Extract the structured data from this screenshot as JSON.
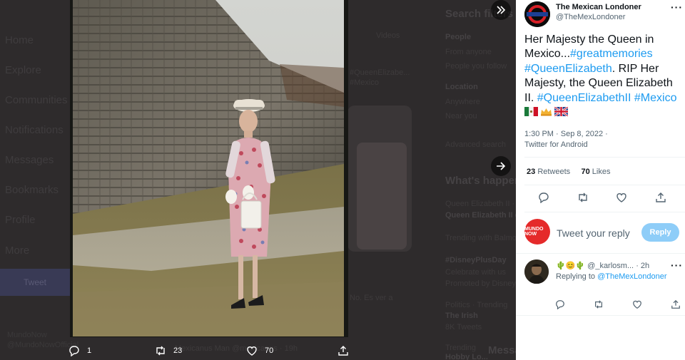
{
  "background": {
    "nav": [
      "Home",
      "Explore",
      "Communities",
      "Notifications",
      "Messages",
      "Bookmarks",
      "Profile",
      "More"
    ],
    "tweet_button": "Tweet",
    "account_name": "MundoNow",
    "account_handle": "@MundoNowOfficial",
    "search_title": "Search filters",
    "videos_tab": "Videos",
    "people_label": "People",
    "from_anyone": "From anyone",
    "people_you_follow": "People you follow",
    "location_label": "Location",
    "anywhere": "Anywhere",
    "near_you": "Near you",
    "advanced_search": "Advanced search",
    "whats_happening": "What's happening",
    "trend1_meta": "Queen Elizabeth II · LIVE",
    "trend1_title": "Queen Elizabeth II dies at 96",
    "trend1_sub": "Trending with Balmoral",
    "trend2_title": "#DisneyPlusDay",
    "trend2_sub": "Celebrate with us",
    "trend2_promo": "Promoted by Disney+",
    "trend3_meta": "Politics · Trending",
    "trend3_title": "The Irish",
    "trend3_sub": "8K Tweets",
    "trend4_meta": "Trending",
    "trend4_title": "Hobby Lo...",
    "messages_drawer": "Messages",
    "bg_author": "Mexicanus Man @mexicanus · 19h",
    "bg_tweet_fragment": "#QueenElizabe...",
    "bg_mexico": "#Mexico",
    "bg_es_verdad": "No. Es ver a"
  },
  "media_bar": {
    "replies": "1",
    "retweets": "23",
    "likes": "70"
  },
  "tweet": {
    "author_name": "The Mexican Londoner",
    "author_handle": "@TheMexLondoner",
    "text_1": "Her Majesty the Queen in Mexico...",
    "tag_1": "#greatmemories",
    "tag_2": "#QueenElizabeth",
    "text_2": ". RIP Her Majesty, the Queen Elizabeth II. ",
    "tag_3": "#QueenElizabethII",
    "tag_4": "#Mexico",
    "timestamp": "1:30 PM · Sep 8, 2022 ·",
    "source": "Twitter for Android",
    "retweets_count": "23",
    "retweets_label": "Retweets",
    "likes_count": "70",
    "likes_label": "Likes"
  },
  "compose": {
    "avatar_text": "MUNDO NOW",
    "placeholder": "Tweet your reply",
    "reply_button": "Reply"
  },
  "reply": {
    "emoji_name": "🌵😊🌵",
    "handle": "@_karlosm...",
    "time": "· 2h",
    "replying_to_label": "Replying to",
    "replying_to_handle": "@TheMexLondoner"
  },
  "colors": {
    "accent": "#1d9bf0",
    "reply_button_disabled": "#8ecdf8",
    "text_primary": "#0f1419",
    "text_secondary": "#536471"
  }
}
